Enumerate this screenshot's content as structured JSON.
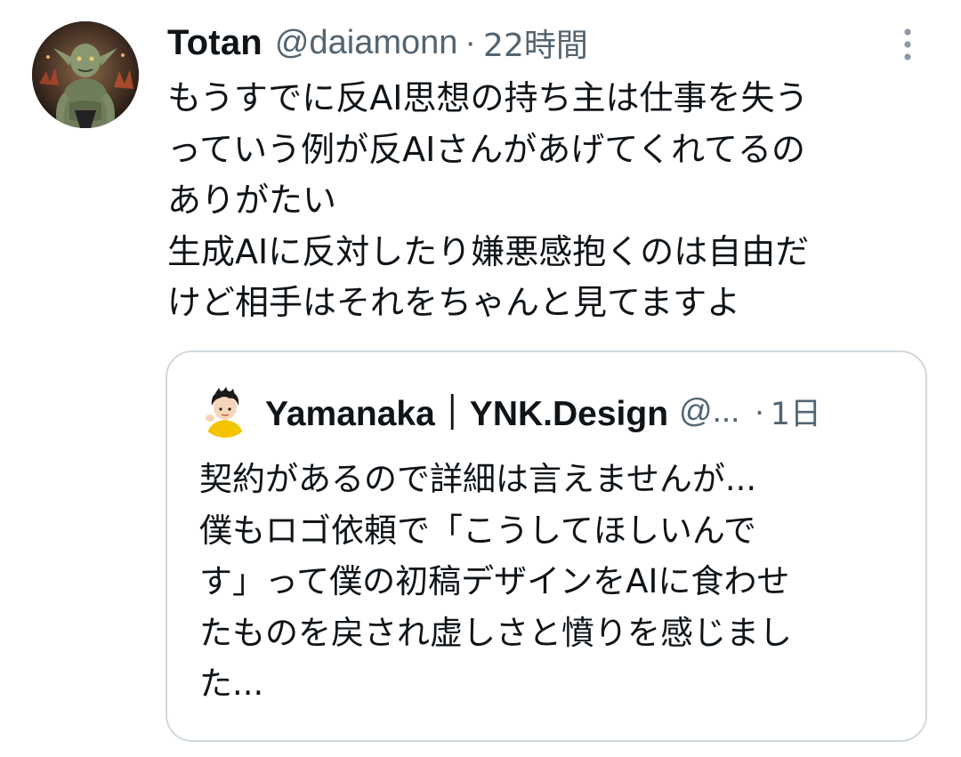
{
  "tweet": {
    "display_name": "Totan",
    "handle": "@daiamonn",
    "separator": "·",
    "time": "22時間",
    "more_icon": "more-vertical-icon",
    "body_lines": [
      "もうすでに反AI思想の持ち主は仕事を失う",
      "っていう例が反AIさんがあげてくれてるの",
      "ありがたい",
      "生成AIに反対したり嫌悪感抱くのは自由だ",
      "けど相手はそれをちゃんと見てますよ"
    ]
  },
  "quote": {
    "display_name": "Yamanaka｜YNK.Design",
    "handle": "@...",
    "separator": "·",
    "time": "1日",
    "body_lines": [
      "契約があるので詳細は言えませんが...",
      "僕もロゴ依頼で「こうしてほしいんで",
      "す」って僕の初稿デザインをAIに食わせ",
      "たものを戻され虚しさと憤りを感じまし",
      "た..."
    ]
  },
  "colors": {
    "text_primary": "#0f1419",
    "text_secondary": "#536471",
    "border": "#cfd9de",
    "background": "#ffffff"
  }
}
